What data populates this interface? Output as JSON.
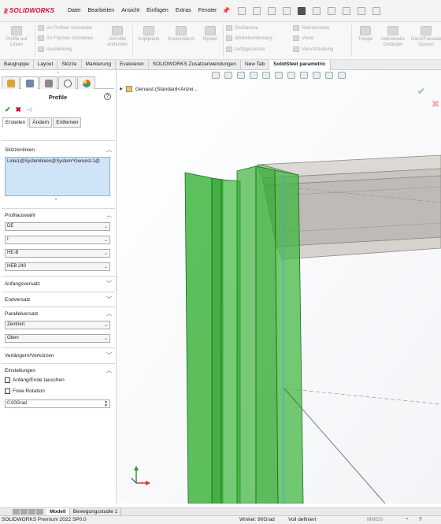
{
  "app": {
    "brand": "SOLIDWORKS",
    "brand_color": "#c8102e"
  },
  "menu": [
    "Datei",
    "Bearbeiten",
    "Ansicht",
    "Einfügen",
    "Extras",
    "Fenster"
  ],
  "ribbon": {
    "profile_button": "Profile auf Linien",
    "cut_profiles": "An Profilen schneiden",
    "cut_faces": "An Flächen schneiden",
    "notch": "Ausklinkung",
    "cut_edges": "Schnitte entfernen",
    "head_plate": "Kopfplatte",
    "gusset": "Knotenblech",
    "rib": "Rippen",
    "butt_strap": "Stoßlasche",
    "angle_connection": "Winkelverbindung",
    "support_plate": "Auflagerasche",
    "frame_corner": "Rahmenecke",
    "haunch": "Voute",
    "bracing": "Verschraubung",
    "stair": "Treppe",
    "railing": "Individuelle Geländer",
    "roof": "Dach/Fassade System"
  },
  "tabs": [
    "Baugruppe",
    "Layout",
    "Skizze",
    "Markierung",
    "Evaluieren",
    "SOLIDWORKS Zusatzanwendungen",
    "New Tab",
    "SolidSteel parametric"
  ],
  "active_tab": "SolidSteel parametric",
  "panel": {
    "title": "Profile",
    "help": "?",
    "subtabs": [
      "Erstellen",
      "Ändern",
      "Entfernen"
    ],
    "sketch_lines_label": "Skizzenlinien",
    "sketch_lines_value": "Linie1@Systemlinien@System^Geruest-1@",
    "profile_selection_label": "Profilauswahl",
    "profile_standard": "DE",
    "profile_type": "I",
    "profile_series": "HE-B",
    "profile_size": "HEB 240",
    "start_offset_label": "Anfangsversatz",
    "end_offset_label": "Endversatz",
    "parallel_offset_label": "Parallelversatz",
    "parallel_h": "Zentriert",
    "parallel_v": "Oben",
    "extend_label": "Verlängern/Verkürzen",
    "settings_label": "Einstellungen",
    "swap_start_end": "Anfang/Ende tauschen",
    "free_rotation": "Freie Rotation",
    "angle_value": "0.00Grad"
  },
  "viewport": {
    "tree_item": "Geruest  (Standard<Anzei...",
    "beam_color": "#2fae2f",
    "beam_edge_color": "#1a6b1a",
    "profile_gray": "#c9c6c1"
  },
  "bottom_tabs": [
    "Modell",
    "Bewegungsstudie 1"
  ],
  "status": {
    "product": "SOLIDWORKS Premium 2022 SP0.0",
    "angle": "Winkel: 90Grad",
    "defined": "Voll definiert",
    "units": "MMGS"
  }
}
